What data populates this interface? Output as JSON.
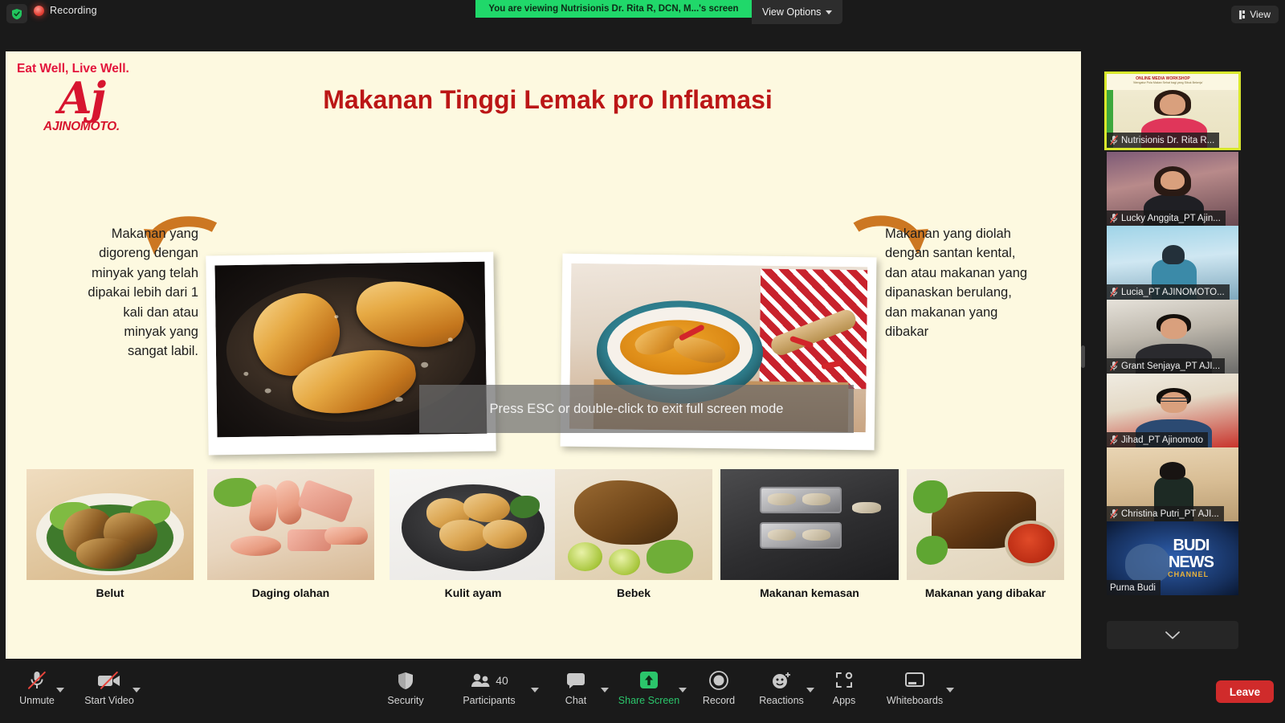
{
  "topbar": {
    "shield_icon": "shield-check-icon",
    "recording_label": "Recording",
    "viewing_banner": "You are viewing Nutrisionis Dr. Rita R, DCN, M...'s screen",
    "view_options_label": "View Options",
    "view_button_label": "View"
  },
  "slide": {
    "tagline": "Eat Well, Live Well.",
    "logo_mark": "Aj",
    "logo_name": "AJINOMOTO.",
    "title": "Makanan Tinggi Lemak pro Inflamasi",
    "left_text": "Makanan yang digoreng dengan minyak yang telah dipakai lebih dari 1 kali dan atau minyak yang sangat labil.",
    "right_text": "Makanan yang diolah dengan santan kental, dan atau makanan yang dipanaskan berulang, dan makanan yang dibakar",
    "foods": [
      {
        "caption": "Belut"
      },
      {
        "caption": "Daging olahan"
      },
      {
        "caption": "Kulit ayam"
      },
      {
        "caption": "Bebek"
      },
      {
        "caption": "Makanan kemasan"
      },
      {
        "caption": "Makanan yang dibakar"
      }
    ]
  },
  "overlay": {
    "exit_fullscreen_text": "Press ESC or double-click to exit full screen mode"
  },
  "sidebar": {
    "participants": [
      {
        "name": "Nutrisionis Dr. Rita R...",
        "muted": true,
        "active": true
      },
      {
        "name": "Lucky Anggita_PT Ajin...",
        "muted": true,
        "active": false
      },
      {
        "name": "Lucia_PT AJINOMOTO...",
        "muted": true,
        "active": false
      },
      {
        "name": "Grant Senjaya_PT AJI...",
        "muted": true,
        "active": false
      },
      {
        "name": "Jihad_PT Ajinomoto",
        "muted": true,
        "active": false
      },
      {
        "name": "Christina Putri_PT AJI...",
        "muted": true,
        "active": false
      },
      {
        "name": "Purna Budi",
        "muted": false,
        "active": false
      }
    ],
    "rita_slide_header": "ONLINE MEDIA WORKSHOP",
    "rita_slide_sub": "'Mengatur Pola Makan Sehat bagi yang Sibuk Bekerja'",
    "budi_line1": "BUDI",
    "budi_line2": "NEWS",
    "budi_line3": "CHANNEL",
    "scroll_down_icon": "chevron-down-icon"
  },
  "toolbar": {
    "items": [
      {
        "label": "Unmute",
        "icon": "microphone-off-icon",
        "caret": true
      },
      {
        "label": "Start Video",
        "icon": "video-off-icon",
        "caret": true
      },
      {
        "label": "Security",
        "icon": "shield-icon",
        "caret": false
      },
      {
        "label": "Participants",
        "icon": "participants-icon",
        "caret": true,
        "count": "40"
      },
      {
        "label": "Chat",
        "icon": "chat-bubble-icon",
        "caret": true
      },
      {
        "label": "Share Screen",
        "icon": "share-screen-icon",
        "caret": true,
        "active": true
      },
      {
        "label": "Record",
        "icon": "record-circle-icon",
        "caret": false
      },
      {
        "label": "Reactions",
        "icon": "reactions-smiley-icon",
        "caret": true
      },
      {
        "label": "Apps",
        "icon": "apps-icon",
        "caret": false
      },
      {
        "label": "Whiteboards",
        "icon": "whiteboard-icon",
        "caret": true
      }
    ],
    "leave_label": "Leave"
  },
  "colors": {
    "brand_red": "#d7152f",
    "title_red": "#bb1616",
    "slide_bg": "#fdf9e0",
    "banner_green": "#20d86a",
    "share_green": "#2bc56b",
    "leave_red": "#d02b2b",
    "active_border": "#d9e82c"
  }
}
